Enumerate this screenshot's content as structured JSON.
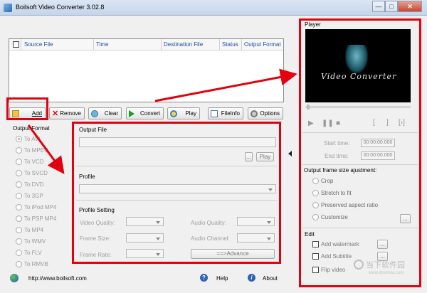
{
  "window": {
    "title": "Boilsoft Video Converter 3.02.8",
    "minimize": "—",
    "maximize": "□",
    "close": "✕"
  },
  "list": {
    "columns": [
      "Source File",
      "Time",
      "Destination File",
      "Status",
      "Output Format"
    ]
  },
  "toolbar": {
    "add": "Add",
    "remove": "Remove",
    "clear": "Clear",
    "convert": "Convert",
    "play": "Play",
    "fileinfo": "FileInfo",
    "options": "Options"
  },
  "output_format": {
    "title": "Output Format",
    "selected": 0,
    "options": [
      "To AVI",
      "To MPEG",
      "To VCD",
      "To SVCD",
      "To DVD",
      "To 3GP",
      "To iPod MP4",
      "To PSP MP4",
      "To MP4",
      "To WMV",
      "To FLV",
      "To RMVB"
    ]
  },
  "output_file": {
    "title": "Output File",
    "browse": "...",
    "play": "Play"
  },
  "profile": {
    "title": "Profile"
  },
  "profile_setting": {
    "title": "Profile Setting",
    "video_quality": "Video Quality:",
    "audio_quality": "Audio Quality:",
    "frame_size": "Frame Size:",
    "audio_channel": "Audio Channel:",
    "frame_rate": "Frame Rate:",
    "advance": "==>Advance"
  },
  "player": {
    "title": "Player",
    "logo_text": "Video Converter",
    "start_label": "Start time:",
    "start_value": "00:00:00.000",
    "end_label": "End time:",
    "end_value": "00:00:00.000"
  },
  "frame_size": {
    "title": "Output frame size ajustment:",
    "options": [
      "Crop",
      "Stretch to fit",
      "Preserved aspect ratio",
      "Customize"
    ],
    "customize_btn": "..."
  },
  "edit": {
    "title": "Edit",
    "add_watermark": "Add watermark",
    "add_subtitle": "Add Subtitle",
    "flip_video": "Flip video",
    "btn": "..."
  },
  "footer": {
    "url": "http://www.boilsoft.com",
    "help": "Help",
    "about": "About"
  },
  "watermark": {
    "text": "当下软件园",
    "url": "www.downxia.com"
  },
  "colors": {
    "highlight": "#e3000f",
    "link": "#1e4fa0"
  }
}
